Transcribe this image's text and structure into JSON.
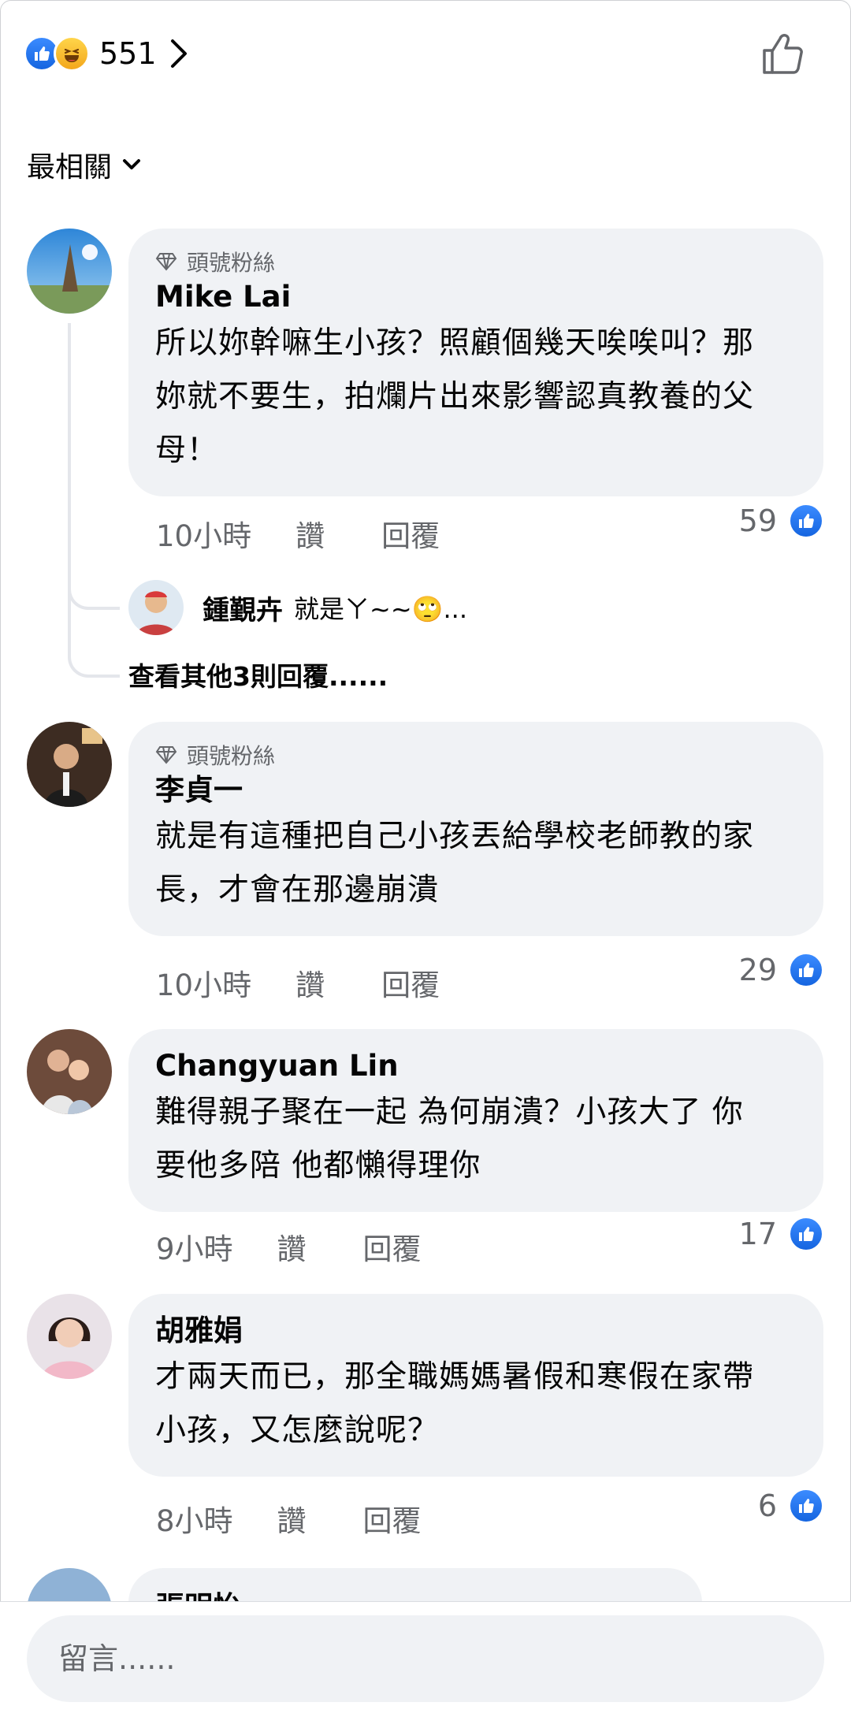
{
  "header": {
    "reaction_icons": [
      "like-reaction-icon",
      "haha-reaction-icon"
    ],
    "reaction_count": "551",
    "like_button_icon": "thumbs-up-outline-icon"
  },
  "sort": {
    "label": "最相關",
    "icon": "chevron-down-icon"
  },
  "comments": [
    {
      "badge": "頭號粉絲",
      "author": "Mike  Lai",
      "lines": [
        "所以妳幹嘛生小孩？照顧個幾天唉唉叫？那",
        "妳就不要生，拍爛片出來影響認真教養的父",
        "母！"
      ],
      "time": "10小時",
      "like_label": "讚",
      "reply_label": "回覆",
      "likes": "59",
      "reply_preview": {
        "author": "鍾覲卉",
        "text": "就是ㄚ~~🙄..."
      },
      "more_replies": "查看其他3則回覆......"
    },
    {
      "badge": "頭號粉絲",
      "author": "李貞一",
      "lines": [
        "就是有這種把自己小孩丟給學校老師教的家",
        "長，才會在那邊崩潰"
      ],
      "time": "10小時",
      "like_label": "讚",
      "reply_label": "回覆",
      "likes": "29"
    },
    {
      "author": "Changyuan Lin",
      "lines": [
        "難得親子聚在一起 為何崩潰？小孩大了 你",
        "要他多陪 他都懶得理你"
      ],
      "time": "9小時",
      "like_label": "讚",
      "reply_label": "回覆",
      "likes": "17"
    },
    {
      "author": "胡雅娟",
      "lines": [
        "才兩天而已，那全職媽媽暑假和寒假在家帶",
        "小孩，又怎麼說呢？"
      ],
      "time": "8小時",
      "like_label": "讚",
      "reply_label": "回覆",
      "likes": "6"
    }
  ],
  "partial_comment": {
    "author_fragment": "張明怡"
  },
  "composer": {
    "placeholder": "留言......"
  },
  "colors": {
    "bubble_bg": "#f0f2f5",
    "secondary_text": "#65676b",
    "like_blue": "#1877f2",
    "haha_yellow": "#f7b928"
  }
}
